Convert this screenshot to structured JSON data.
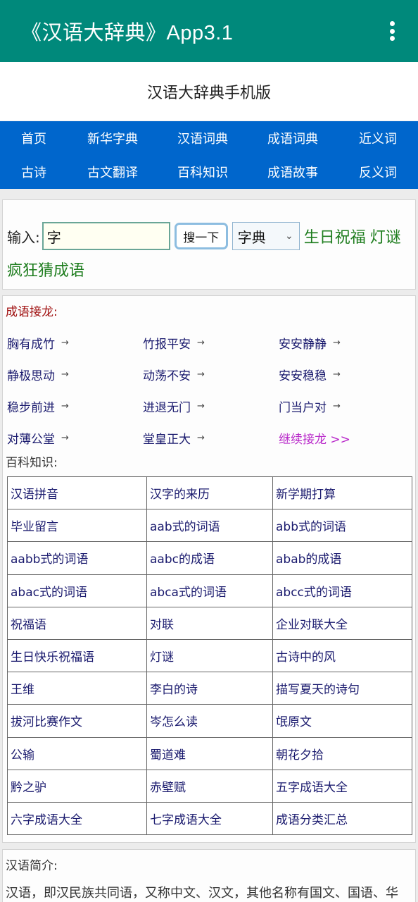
{
  "appbar": {
    "title": "《汉语大辞典》App3.1",
    "menu_icon": "more-vert-icon"
  },
  "site": {
    "header": "汉语大辞典手机版"
  },
  "nav": {
    "items": [
      {
        "label": "首页"
      },
      {
        "label": "新华字典"
      },
      {
        "label": "汉语词典"
      },
      {
        "label": "成语词典"
      },
      {
        "label": "近义词"
      },
      {
        "label": "古诗"
      },
      {
        "label": "古文翻译"
      },
      {
        "label": "百科知识"
      },
      {
        "label": "成语故事"
      },
      {
        "label": "反义词"
      }
    ]
  },
  "search": {
    "label": "输入:",
    "value": "字",
    "button_label": "搜一下",
    "select_value": "字典",
    "links": [
      "生日祝福",
      "灯谜",
      "疯狂猜成语"
    ]
  },
  "chain": {
    "title": "成语接龙:",
    "items": [
      "胸有成竹",
      "竹报平安",
      "安安静静",
      "静极思动",
      "动荡不安",
      "安安稳稳",
      "稳步前进",
      "进退无门",
      "门当户对",
      "对薄公堂",
      "堂皇正大"
    ],
    "arrow": "→",
    "more_label": "继续接龙 >>"
  },
  "baike": {
    "title": "百科知识:",
    "rows": [
      [
        "汉语拼音",
        "汉字的来历",
        "新学期打算"
      ],
      [
        "毕业留言",
        "aab式的词语",
        "abb式的词语"
      ],
      [
        "aabb式的词语",
        "aabc的成语",
        "abab的成语"
      ],
      [
        "abac式的词语",
        "abca式的词语",
        "abcc式的词语"
      ],
      [
        "祝福语",
        "对联",
        "企业对联大全"
      ],
      [
        "生日快乐祝福语",
        "灯谜",
        "古诗中的风"
      ],
      [
        "王维",
        "李白的诗",
        "描写夏天的诗句"
      ],
      [
        "拔河比赛作文",
        "岑怎么读",
        "氓原文"
      ],
      [
        "公输",
        "蜀道难",
        "朝花夕拾"
      ],
      [
        "黔之驴",
        "赤壁赋",
        "五字成语大全"
      ],
      [
        "六字成语大全",
        "七字成语大全",
        "成语分类汇总"
      ]
    ]
  },
  "intro": {
    "title": "汉语简介:",
    "text": "汉语，即汉民族共同语，又称中文、汉文，其他名称有国文、国语、华"
  },
  "colors": {
    "appbar": "#00897b",
    "nav": "#0066cc",
    "link": "#1a1a6e",
    "green_link": "#1e7d1e",
    "more_link": "#b827c9",
    "red_title": "#a01010"
  }
}
